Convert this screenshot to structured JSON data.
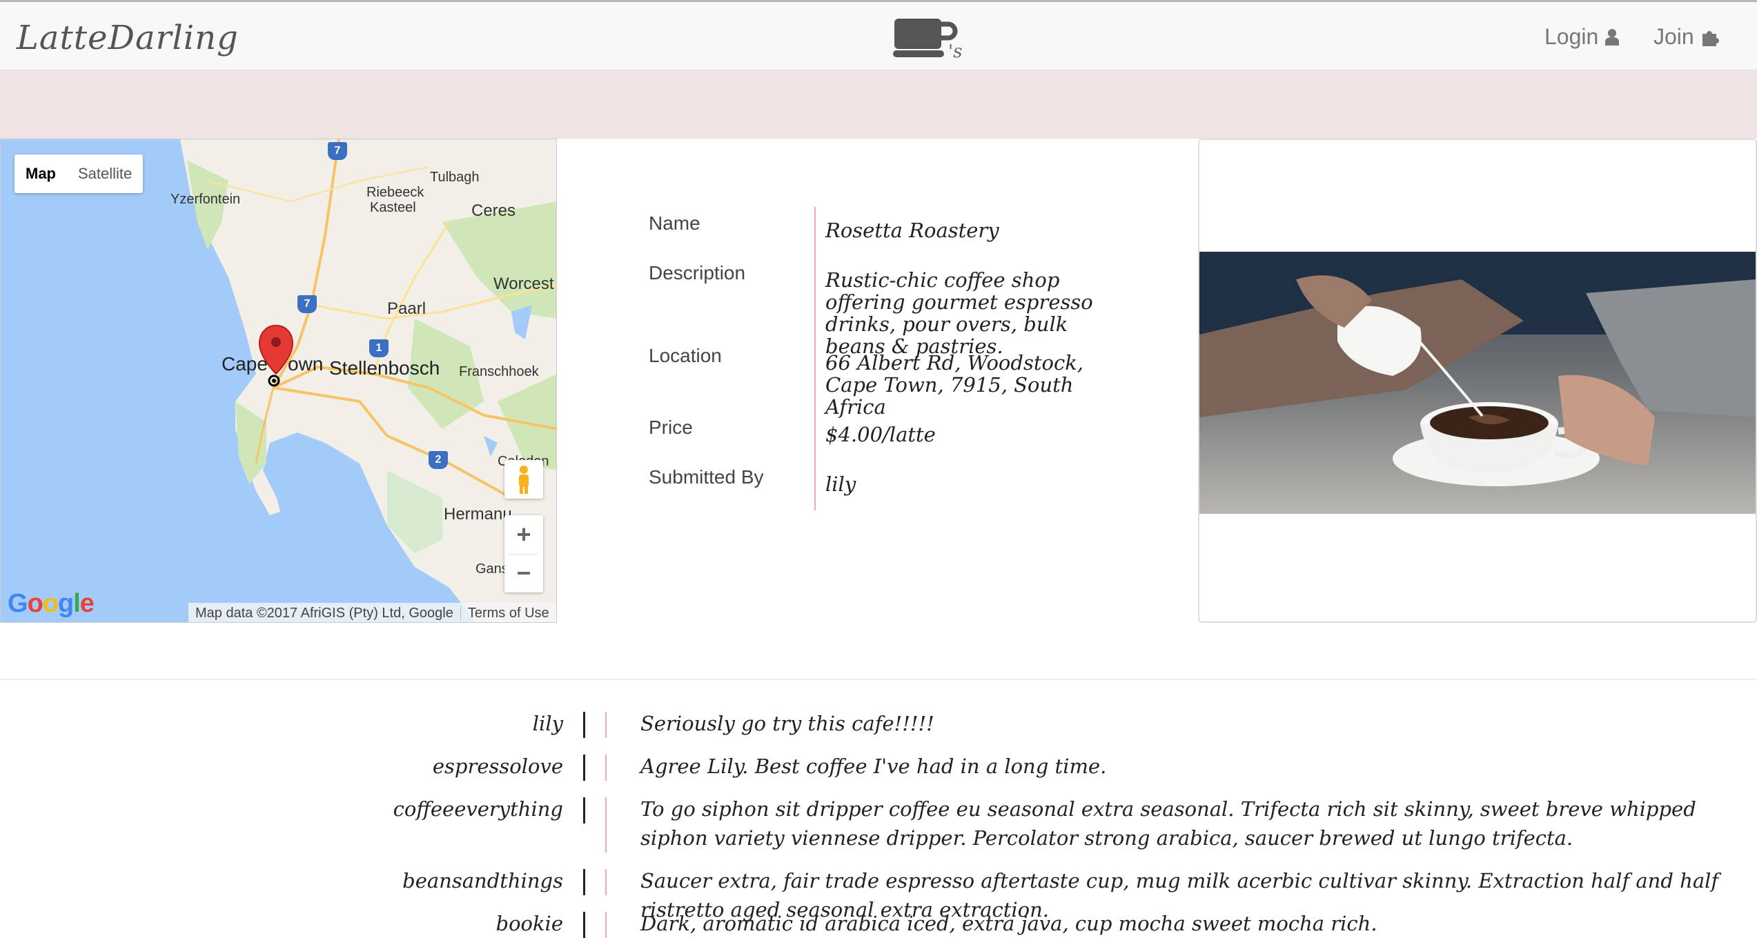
{
  "header": {
    "brand": "LatteDarling",
    "logo_suffix": "'s",
    "login_label": "Login",
    "join_label": "Join"
  },
  "map": {
    "type_map": "Map",
    "type_satellite": "Satellite",
    "attribution": "Map data ©2017 AfriGIS (Pty) Ltd, Google",
    "terms": "Terms of Use",
    "google_label": "Google",
    "places": {
      "yzerfontein": "Yzerfontein",
      "riebeeck1": "Riebeeck",
      "riebeeck2": "Kasteel",
      "tulbagh": "Tulbagh",
      "ceres": "Ceres",
      "worcester": "Worcest",
      "paarl": "Paarl",
      "capetown1": "Cape",
      "capetown2": "own",
      "stellenbosch": "Stellenbosch",
      "franschhoek": "Franschhoek",
      "caledon": "Caledon",
      "hermanus": "Hermanu",
      "gans": "Gans"
    },
    "shields": [
      "7",
      "7",
      "1",
      "2"
    ]
  },
  "details": {
    "name_label": "Name",
    "name_value": "Rosetta Roastery",
    "description_label": "Description",
    "description_value": "Rustic-chic coffee shop offering gourmet espresso drinks, pour overs, bulk beans & pastries.",
    "location_label": "Location",
    "location_value": "66 Albert Rd, Woodstock, Cape Town, 7915, South Africa",
    "price_label": "Price",
    "price_value": "$4.00/latte",
    "submitted_label": "Submitted By",
    "submitted_value": "lily"
  },
  "comments": [
    {
      "user": "lily",
      "text": "Seriously go try this cafe!!!!!"
    },
    {
      "user": "espressolove",
      "text": "Agree Lily. Best coffee I've had in a long time."
    },
    {
      "user": "coffeeeverything",
      "text": "To go siphon sit dripper coffee eu seasonal extra seasonal. Trifecta rich sit skinny, sweet breve whipped siphon variety viennese dripper. Percolator strong arabica, saucer brewed ut lungo trifecta."
    },
    {
      "user": "beansandthings",
      "text": "Saucer extra, fair trade espresso aftertaste cup, mug milk acerbic cultivar skinny. Extraction half and half ristretto aged seasonal extra extraction."
    },
    {
      "user": "bookie",
      "text": "Dark, aromatic id arabica iced, extra java, cup mocha sweet mocha rich."
    }
  ],
  "colors": {
    "accent_pink": "#f2a9b7",
    "band": "#efe3e2",
    "marker": "#e53935"
  }
}
